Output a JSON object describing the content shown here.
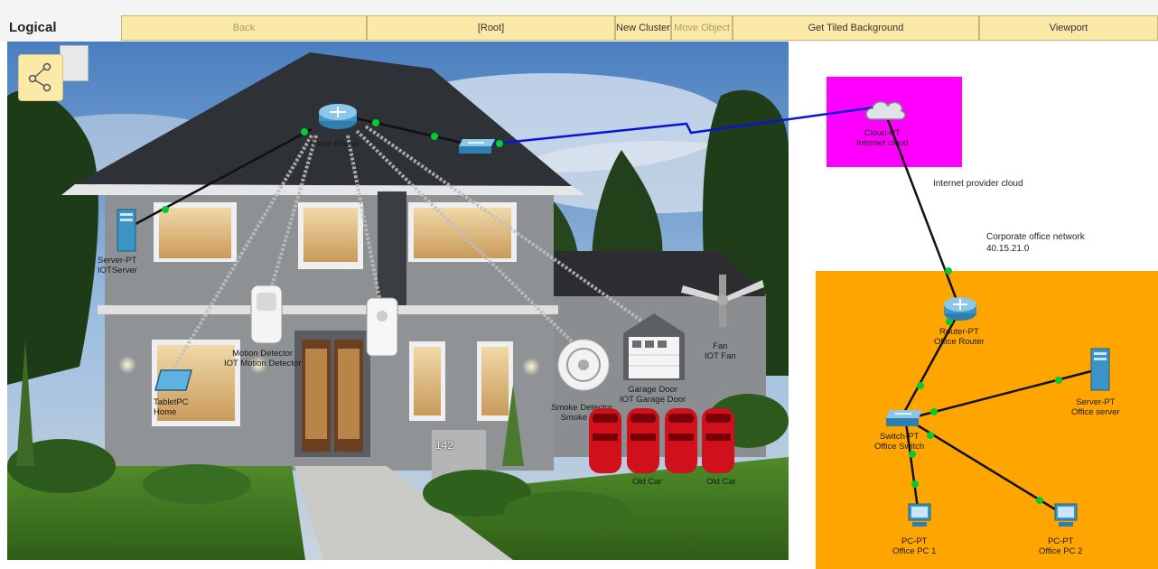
{
  "toolbar": {
    "mode": "Logical",
    "buttons": {
      "back": "Back",
      "root": "[Root]",
      "new_cluster": "New Cluster",
      "move_object": "Move Object",
      "tiled_bg": "Get Tiled Background",
      "viewport": "Viewport"
    }
  },
  "house_number": "142",
  "devices": {
    "home_router": {
      "type": "Home Router",
      "name": ""
    },
    "home_switch": {
      "type": "",
      "name": ""
    },
    "iot_server": {
      "type": "Server-PT",
      "name": "IOTServer"
    },
    "tablet": {
      "type": "TabletPC",
      "name": "Home"
    },
    "motion": {
      "type": "Motion Detector",
      "name": "IOT Motion Detector"
    },
    "siren": {
      "type": "",
      "name": ""
    },
    "smoke": {
      "type": "Smoke Detector",
      "name": "Smoke Det"
    },
    "garage": {
      "type": "Garage Door",
      "name": "IOT Garage Door"
    },
    "fan": {
      "type": "Fan",
      "name": "IOT Fan"
    },
    "old_car": {
      "label": "Old Car"
    },
    "cloud": {
      "type": "Cloud-PT",
      "name": "Internet cloud"
    },
    "office_router": {
      "type": "Router-PT",
      "name": "Office Router"
    },
    "office_switch": {
      "type": "Switch-PT",
      "name": "Office Switch"
    },
    "office_server": {
      "type": "Server-PT",
      "name": "Office server"
    },
    "office_pc1": {
      "type": "PC-PT",
      "name": "Office PC 1"
    },
    "office_pc2": {
      "type": "PC-PT",
      "name": "Office PC 2"
    }
  },
  "notes": {
    "internet": "Internet provider cloud",
    "corporate_title": "Corporate office network",
    "corporate_net": "40.15.21.0"
  },
  "colors": {
    "cluster": "#ff00ff",
    "office": "#ffa500",
    "link_up": "#00cc33",
    "serial_link": "#0000dd",
    "toolbar_button": "#fbe9a8"
  }
}
